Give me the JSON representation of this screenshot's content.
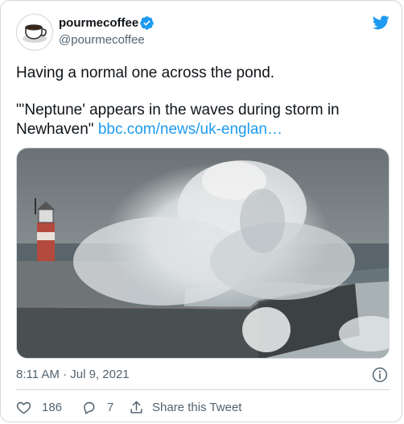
{
  "tweet": {
    "display_name": "pourmecoffee",
    "handle": "@pourmecoffee",
    "text_line1": "Having a normal one across the pond.",
    "text_quote": "\"'Neptune' appears in the waves during storm in Newhaven\"",
    "link_text": "bbc.com/news/uk-englan…",
    "timestamp": "8:11 AM · Jul 9, 2021"
  },
  "actions": {
    "like_count": "186",
    "reply_count": "7",
    "share_label": "Share this Tweet"
  },
  "colors": {
    "accent": "#1d9bf0",
    "muted_text": "#536471",
    "border": "#cfd9de"
  },
  "icons": [
    "coffee-cup-avatar",
    "verified-badge-icon",
    "twitter-bird-icon",
    "info-icon",
    "heart-icon",
    "reply-bubble-icon",
    "share-icon"
  ]
}
